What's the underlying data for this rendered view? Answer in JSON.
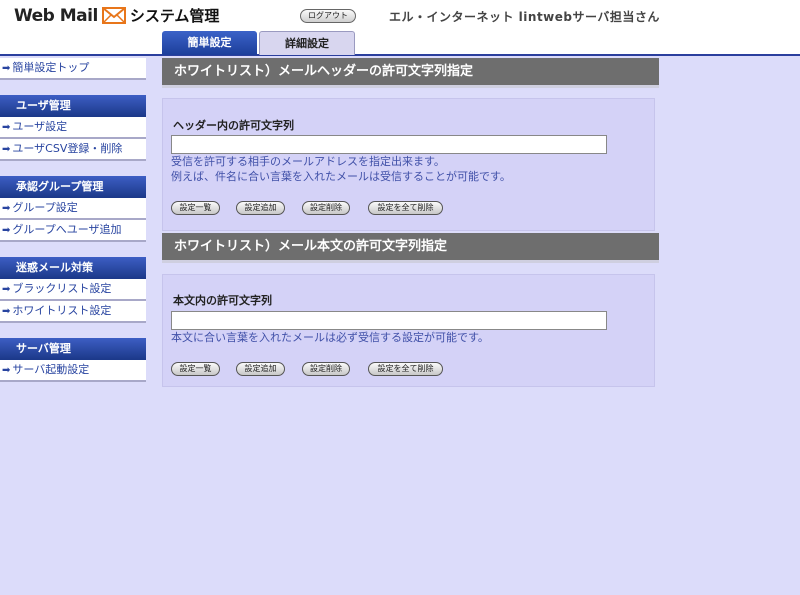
{
  "header": {
    "logo_web": "Web Mail",
    "logo_icon": "envelope-icon",
    "logo_system": "システム管理",
    "logout_label": "ログアウト",
    "user_info": "エル・インターネット lintwebサーバ担当さん"
  },
  "tabs": [
    {
      "label": "簡単設定",
      "active": true
    },
    {
      "label": "詳細設定",
      "active": false
    }
  ],
  "sidebar": {
    "top_link": "簡単設定トップ",
    "groups": [
      {
        "heading": "ユーザ管理",
        "items": [
          "ユーザ設定",
          "ユーザCSV登録・削除"
        ]
      },
      {
        "heading": "承認グループ管理",
        "items": [
          "グループ設定",
          "グループへユーザ追加"
        ]
      },
      {
        "heading": "迷惑メール対策",
        "items": [
          "ブラックリスト設定",
          "ホワイトリスト設定"
        ]
      },
      {
        "heading": "サーバ管理",
        "items": [
          "サーバ起動設定"
        ]
      }
    ]
  },
  "sections": [
    {
      "title": "ホワイトリスト）メールヘッダーの許可文字列指定",
      "field_label": "ヘッダー内の許可文字列",
      "input_value": "",
      "description_lines": [
        "受信を許可する相手のメールアドレスを指定出来ます。",
        "例えば、件名に合い言葉を入れたメールは受信することが可能です。"
      ],
      "buttons": [
        "設定一覧",
        "設定追加",
        "設定削除",
        "設定を全て削除"
      ]
    },
    {
      "title": "ホワイトリスト）メール本文の許可文字列指定",
      "field_label": "本文内の許可文字列",
      "input_value": "",
      "description_lines": [
        "本文に合い言葉を入れたメールは必ず受信する設定が可能です。"
      ],
      "buttons": [
        "設定一覧",
        "設定追加",
        "設定削除",
        "設定を全て削除"
      ]
    }
  ],
  "colors": {
    "page_background": "#dcdcfa",
    "accent_blue": "#2b3f9e",
    "section_bar": "#6e6e6e",
    "panel": "#d4d2f7",
    "link": "#2844a0"
  }
}
